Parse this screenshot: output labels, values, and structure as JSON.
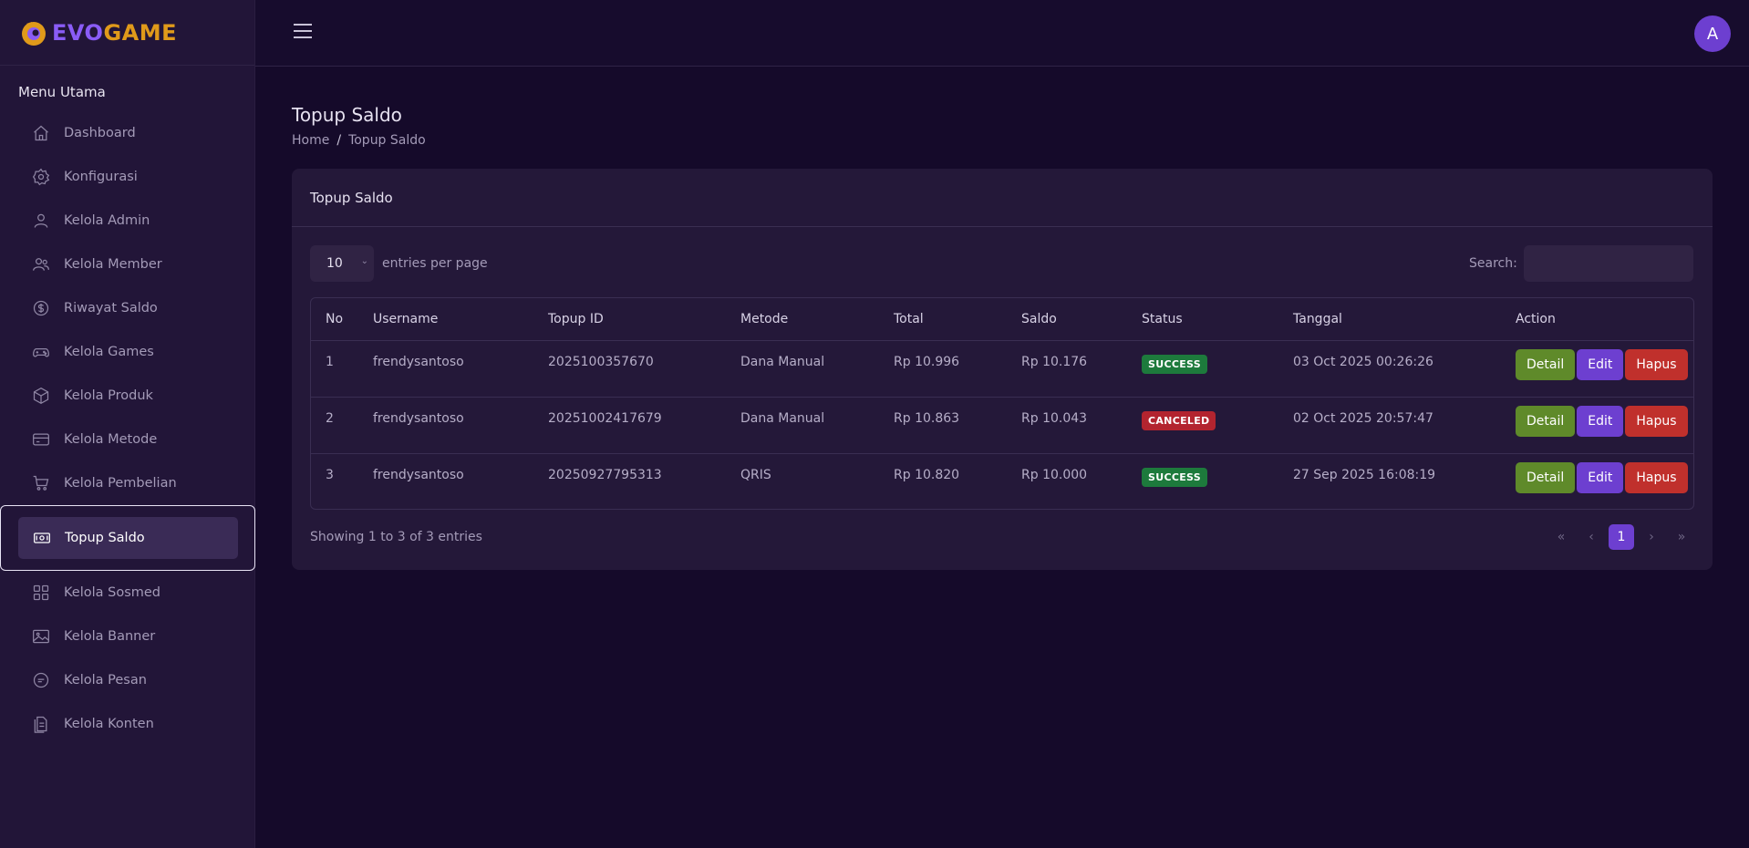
{
  "brand": {
    "part1": "EVO",
    "part2": "GAME"
  },
  "user": {
    "avatar_initial": "A"
  },
  "sidebar": {
    "title": "Menu Utama",
    "items": [
      {
        "label": "Dashboard",
        "icon": "home-icon"
      },
      {
        "label": "Konfigurasi",
        "icon": "gear-icon"
      },
      {
        "label": "Kelola Admin",
        "icon": "user-icon"
      },
      {
        "label": "Kelola Member",
        "icon": "users-icon"
      },
      {
        "label": "Riwayat Saldo",
        "icon": "dollar-icon"
      },
      {
        "label": "Kelola Games",
        "icon": "gamepad-icon"
      },
      {
        "label": "Kelola Produk",
        "icon": "box-icon"
      },
      {
        "label": "Kelola Metode",
        "icon": "card-icon"
      },
      {
        "label": "Kelola Pembelian",
        "icon": "cart-icon"
      },
      {
        "label": "Topup Saldo",
        "icon": "money-icon",
        "active": true
      },
      {
        "label": "Kelola Sosmed",
        "icon": "grid-icon"
      },
      {
        "label": "Kelola Banner",
        "icon": "image-icon"
      },
      {
        "label": "Kelola Pesan",
        "icon": "chat-icon"
      },
      {
        "label": "Kelola Konten",
        "icon": "document-icon"
      }
    ]
  },
  "page": {
    "title": "Topup Saldo",
    "breadcrumb": {
      "home": "Home",
      "sep": "/",
      "current": "Topup Saldo"
    }
  },
  "card": {
    "title": "Topup Saldo",
    "length_value": "10",
    "length_label": "entries per page",
    "search_label": "Search:",
    "search_value": ""
  },
  "table": {
    "columns": [
      "No",
      "Username",
      "Topup ID",
      "Metode",
      "Total",
      "Saldo",
      "Status",
      "Tanggal",
      "Action"
    ],
    "rows": [
      {
        "no": "1",
        "username": "frendysantoso",
        "topup_id": "2025100357670",
        "metode": "Dana Manual",
        "total": "Rp 10.996",
        "saldo": "Rp 10.176",
        "status": "SUCCESS",
        "tanggal": "03 Oct 2025 00:26:26"
      },
      {
        "no": "2",
        "username": "frendysantoso",
        "topup_id": "20251002417679",
        "metode": "Dana Manual",
        "total": "Rp 10.863",
        "saldo": "Rp 10.043",
        "status": "CANCELED",
        "tanggal": "02 Oct 2025 20:57:47"
      },
      {
        "no": "3",
        "username": "frendysantoso",
        "topup_id": "20250927795313",
        "metode": "QRIS",
        "total": "Rp 10.820",
        "saldo": "Rp 10.000",
        "status": "SUCCESS",
        "tanggal": "27 Sep 2025 16:08:19"
      }
    ],
    "actions": {
      "detail": "Detail",
      "edit": "Edit",
      "delete": "Hapus"
    }
  },
  "footer": {
    "info": "Showing 1 to 3 of 3 entries",
    "pager": {
      "first": "«",
      "prev": "‹",
      "current": "1",
      "next": "›",
      "last": "»"
    }
  },
  "colors": {
    "success": "#1d7a3c",
    "canceled": "#b3242f",
    "detail_btn": "#5f8a2a",
    "edit_btn": "#6d3fd0",
    "delete_btn": "#c0302c"
  }
}
